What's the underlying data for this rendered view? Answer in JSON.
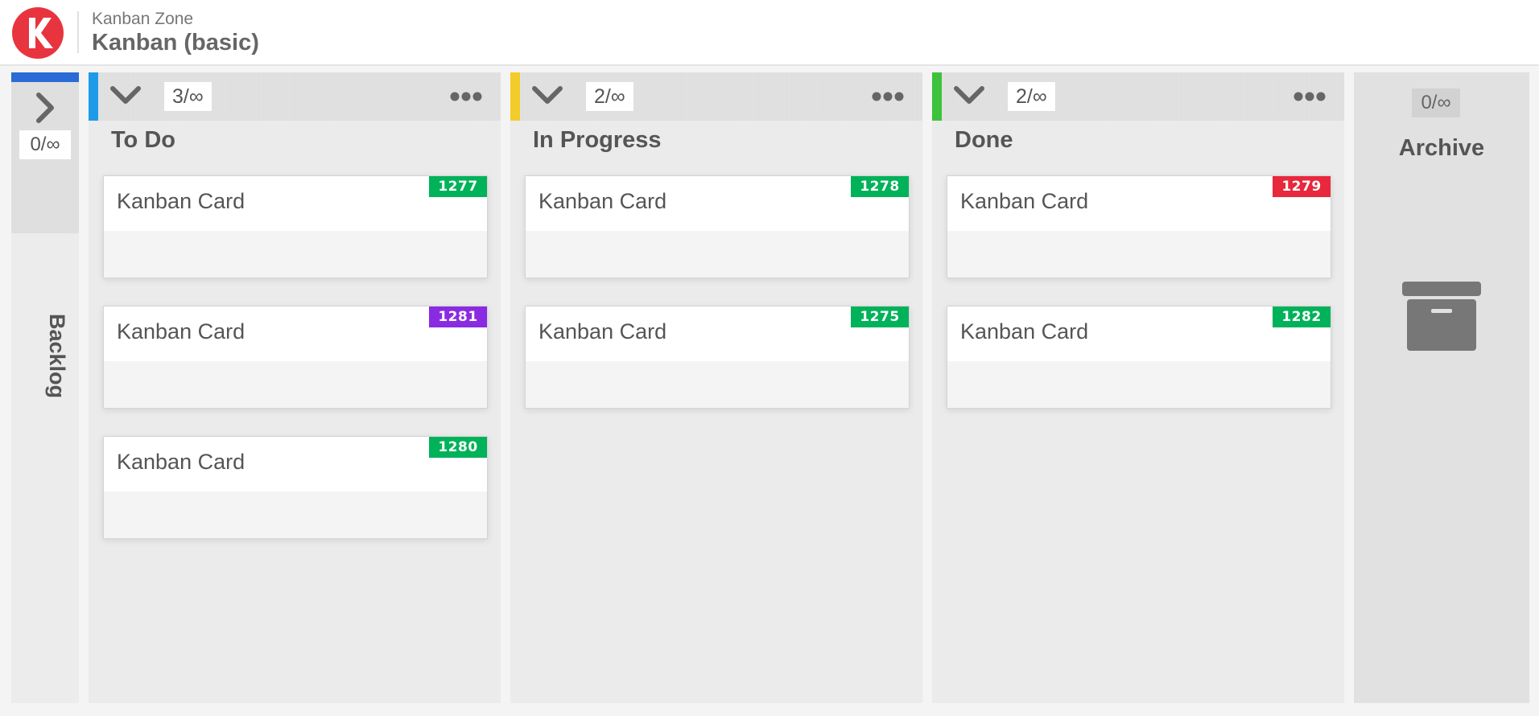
{
  "header": {
    "org_name": "Kanban Zone",
    "board_name": "Kanban (basic)"
  },
  "colors": {
    "brand": "#e8343f",
    "backlog_accent": "#2a6bd6",
    "todo_accent": "#1e9be8",
    "in_progress_accent": "#f2cc2a",
    "done_accent": "#3cc23c",
    "badge_green": "#00b259",
    "badge_purple": "#8a2be2",
    "badge_red": "#e8283c"
  },
  "backlog": {
    "count": "0/∞",
    "label": "Backlog"
  },
  "columns": [
    {
      "title": "To Do",
      "count": "3/∞",
      "cards": [
        {
          "title": "Kanban Card",
          "id": "1277",
          "badge_color": "#00b259"
        },
        {
          "title": "Kanban Card",
          "id": "1281",
          "badge_color": "#8a2be2"
        },
        {
          "title": "Kanban Card",
          "id": "1280",
          "badge_color": "#00b259"
        }
      ]
    },
    {
      "title": "In Progress",
      "count": "2/∞",
      "cards": [
        {
          "title": "Kanban Card",
          "id": "1278",
          "badge_color": "#00b259"
        },
        {
          "title": "Kanban Card",
          "id": "1275",
          "badge_color": "#00b259"
        }
      ]
    },
    {
      "title": "Done",
      "count": "2/∞",
      "cards": [
        {
          "title": "Kanban Card",
          "id": "1279",
          "badge_color": "#e8283c"
        },
        {
          "title": "Kanban Card",
          "id": "1282",
          "badge_color": "#00b259"
        }
      ]
    }
  ],
  "archive": {
    "count": "0/∞",
    "title": "Archive"
  },
  "icons": {
    "logo": "kanban-zone-logo",
    "expand": "chevron-right-icon",
    "collapse": "chevron-down-icon",
    "menu": "more-horizontal-icon",
    "archive": "archive-box-icon"
  }
}
